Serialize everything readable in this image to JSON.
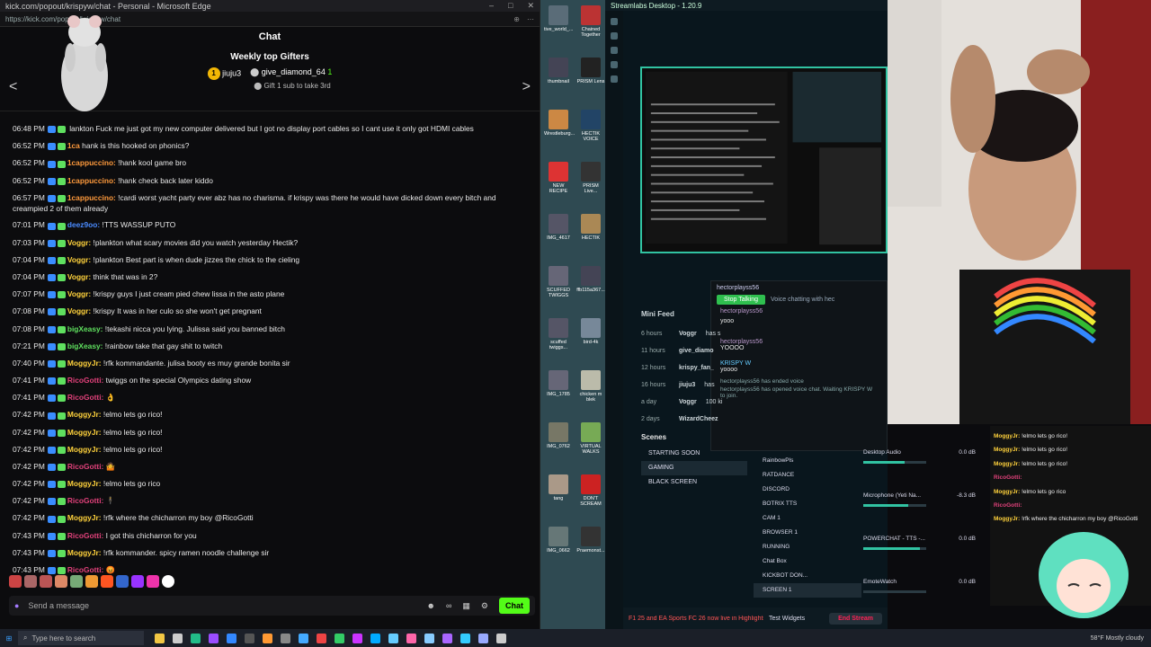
{
  "browser": {
    "title": "kick.com/popout/krispyw/chat - Personal - Microsoft Edge",
    "url": "https://kick.com/popout/krispyw/chat"
  },
  "chat": {
    "header": "Chat",
    "gifters_title": "Weekly top Gifters",
    "gifter1": "jiuju3",
    "gifter2": "give_diamond_64",
    "gifter2_count": "1",
    "gift_sub_text": "Gift 1 sub to take 3rd",
    "messages": [
      {
        "time": "06:48 PM",
        "user": "",
        "color": "#e9e9e9",
        "text": "lankton Fuck me just got my new computer delivered but I got no display port cables so I cant use it only got HDMI cables"
      },
      {
        "time": "06:52 PM",
        "user": "1ca",
        "color": "#ff9a3c",
        "text": "hank is this hooked on phonics?"
      },
      {
        "time": "06:52 PM",
        "user": "1cappuccino:",
        "color": "#ff9a3c",
        "text": "!hank kool game bro"
      },
      {
        "time": "06:52 PM",
        "user": "1cappuccino:",
        "color": "#ff9a3c",
        "text": "!hank check back later kiddo"
      },
      {
        "time": "06:57 PM",
        "user": "1cappuccino:",
        "color": "#ff9a3c",
        "text": "!cardi worst yacht party ever abz has no charisma. if krispy was there he would have dicked down every bitch and creampied 2 of them already",
        "wrap": true
      },
      {
        "time": "07:01 PM",
        "user": "deez9oo:",
        "color": "#4a8bff",
        "text": "!TTS WASSUP PUTO"
      },
      {
        "time": "07:03 PM",
        "user": "Voggr:",
        "color": "#ffd23c",
        "text": "!plankton what scary movies did you watch yesterday Hectik?"
      },
      {
        "time": "07:04 PM",
        "user": "Voggr:",
        "color": "#ffd23c",
        "text": "!plankton Best part is when dude jizzes the chick to the cieling"
      },
      {
        "time": "07:04 PM",
        "user": "Voggr:",
        "color": "#ffd23c",
        "text": "think that was in 2?"
      },
      {
        "time": "07:07 PM",
        "user": "Voggr:",
        "color": "#ffd23c",
        "text": "!krispy guys I just cream pied chew lissa in the asto plane"
      },
      {
        "time": "07:08 PM",
        "user": "Voggr:",
        "color": "#ffd23c",
        "text": "!krispy It was in her culo so she won't get pregnant"
      },
      {
        "time": "07:08 PM",
        "user": "bigXeasy:",
        "color": "#5fe05f",
        "text": "!tekashi nicca you lying. Julissa said you banned bitch"
      },
      {
        "time": "07:21 PM",
        "user": "bigXeasy:",
        "color": "#5fe05f",
        "text": "!rainbow take that gay shit to twitch"
      },
      {
        "time": "07:40 PM",
        "user": "MoggyJr:",
        "color": "#ffd23c",
        "text": "!rfk kommandante. julisa booty es muy grande bonita sir"
      },
      {
        "time": "07:41 PM",
        "user": "RicoGotti:",
        "color": "#e0417a",
        "text": "twiggs on the special Olympics dating show"
      },
      {
        "time": "07:41 PM",
        "user": "RicoGotti:",
        "color": "#e0417a",
        "text": "👌"
      },
      {
        "time": "07:42 PM",
        "user": "MoggyJr:",
        "color": "#ffd23c",
        "text": "!elmo lets go rico!"
      },
      {
        "time": "07:42 PM",
        "user": "MoggyJr:",
        "color": "#ffd23c",
        "text": "!elmo lets go rico!"
      },
      {
        "time": "07:42 PM",
        "user": "MoggyJr:",
        "color": "#ffd23c",
        "text": "!elmo lets go rico!"
      },
      {
        "time": "07:42 PM",
        "user": "RicoGotti:",
        "color": "#e0417a",
        "text": "🤷"
      },
      {
        "time": "07:42 PM",
        "user": "MoggyJr:",
        "color": "#ffd23c",
        "text": "!elmo lets go rico"
      },
      {
        "time": "07:42 PM",
        "user": "RicoGotti:",
        "color": "#e0417a",
        "text": "🕴"
      },
      {
        "time": "07:42 PM",
        "user": "MoggyJr:",
        "color": "#ffd23c",
        "text": "!rfk where the chicharron my boy @RicoGotti"
      },
      {
        "time": "07:43 PM",
        "user": "RicoGotti:",
        "color": "#e0417a",
        "text": "I got this chicharron for you"
      },
      {
        "time": "07:43 PM",
        "user": "MoggyJr:",
        "color": "#ffd23c",
        "text": "!rfk kommander. spicy ramen noodle challenge sir"
      },
      {
        "time": "07:43 PM",
        "user": "RicoGotti:",
        "color": "#e0417a",
        "text": "😡"
      }
    ],
    "send_placeholder": "Send a message",
    "chat_button": "Chat"
  },
  "desktop_icons": [
    {
      "label": "tive_world_...",
      "color": "#5a6c78"
    },
    {
      "label": "Chained Together",
      "color": "#b33"
    },
    {
      "label": "thumbnail",
      "color": "#445"
    },
    {
      "label": "PRISM Lens",
      "color": "#222"
    },
    {
      "label": "Wrestleburg...",
      "color": "#c84"
    },
    {
      "label": "HECTIK VOICE",
      "color": "#246"
    },
    {
      "label": "NEW RECIPE",
      "color": "#d33"
    },
    {
      "label": "PRISM Live...",
      "color": "#333"
    },
    {
      "label": "IMG_4617",
      "color": "#556"
    },
    {
      "label": "HECTIK",
      "color": "#a85"
    },
    {
      "label": "SCUFFED TWIGGS",
      "color": "#667"
    },
    {
      "label": "ffb115a367...",
      "color": "#445"
    },
    {
      "label": "scuffed twiggs...",
      "color": "#556"
    },
    {
      "label": "bird-4k",
      "color": "#789"
    },
    {
      "label": "IMG_1785",
      "color": "#667"
    },
    {
      "label": "chicken m blek",
      "color": "#bba"
    },
    {
      "label": "IMG_0762",
      "color": "#776"
    },
    {
      "label": "VIRTUAL WALKS",
      "color": "#7a5"
    },
    {
      "label": "tang",
      "color": "#a98"
    },
    {
      "label": "DON'T SCREAM",
      "color": "#c22"
    },
    {
      "label": "IMG_0662",
      "color": "#677"
    },
    {
      "label": "Praemonst...",
      "color": "#333"
    }
  ],
  "streamlabs": {
    "title": "Streamlabs Desktop - 1.20.9",
    "mini_feed_title": "Mini Feed",
    "feed": [
      {
        "time": "6 hours",
        "user": "Voggr",
        "text": "has s"
      },
      {
        "time": "11 hours",
        "user": "give_diamo",
        "text": ""
      },
      {
        "time": "12 hours",
        "user": "krispy_fan_",
        "text": ""
      },
      {
        "time": "16 hours",
        "user": "jiuju3",
        "text": "has"
      },
      {
        "time": "a day",
        "user": "Voggr",
        "text": "100 ki"
      },
      {
        "time": "2 days",
        "user": "WizardCheez",
        "text": ""
      }
    ],
    "voice": {
      "host": "hectorplayss56",
      "stop_button": "Stop Talking",
      "status": "Voice chatting with hec",
      "m1_user": "hectorplayss56",
      "m1_text": "yooo",
      "m2_user": "hectorplayss56",
      "m2_text": "YOOOO",
      "m3_user": "KRISPY W",
      "m3_text": "yoooo",
      "ended": "hectorplayss56 has ended voice",
      "opened": "hectorplayss56 has opened voice chat. Waiting KRISPY W to join."
    },
    "scenes_title": "Scenes",
    "scenes": [
      "STARTING SOON",
      "GAMING",
      "BLACK SCREEN"
    ],
    "active_scene": "GAMING",
    "sources": [
      "RainbowPls",
      "RATDANCE",
      "DISCORD",
      "BOTRIX TTS",
      "CAM 1",
      "BROWSER 1",
      "RUNNING",
      "Chat Box",
      "KICKBOT DON...",
      "SCREEN 1"
    ],
    "mixer": [
      {
        "name": "Desktop Audio",
        "db": "0.0 dB",
        "level": 0.65
      },
      {
        "name": "Microphone (Yeti Na...",
        "db": "-8.3 dB",
        "level": 0.72
      },
      {
        "name": "POWERCHAT - TTS -...",
        "db": "0.0 dB",
        "level": 0.9
      },
      {
        "name": "EmoteWatch",
        "db": "0.0 dB",
        "level": 0.0
      }
    ],
    "ticker": "F1 25 and EA Sports FC 26 now live in Highlights",
    "test_widgets": "Test Widgets",
    "end_stream": "End Stream"
  },
  "cam_chat": [
    {
      "user": "MoggyJr:",
      "text": "!elmo lets go rico!",
      "color": "#ffd23c"
    },
    {
      "user": "MoggyJr:",
      "text": "!elmo lets go rico!",
      "color": "#ffd23c"
    },
    {
      "user": "MoggyJr:",
      "text": "!elmo lets go rico!",
      "color": "#ffd23c"
    },
    {
      "user": "RicoGotti:",
      "text": "",
      "color": "#e0417a"
    },
    {
      "user": "MoggyJr:",
      "text": "!elmo lets go rico",
      "color": "#ffd23c"
    },
    {
      "user": "RicoGotti:",
      "text": "",
      "color": "#e0417a"
    },
    {
      "user": "MoggyJr:",
      "text": "!rfk where the chicharron my boy @RicoGotti",
      "color": "#ffd23c"
    }
  ],
  "taskbar": {
    "search_placeholder": "Type here to search",
    "weather": "58°F  Mostly cloudy"
  }
}
